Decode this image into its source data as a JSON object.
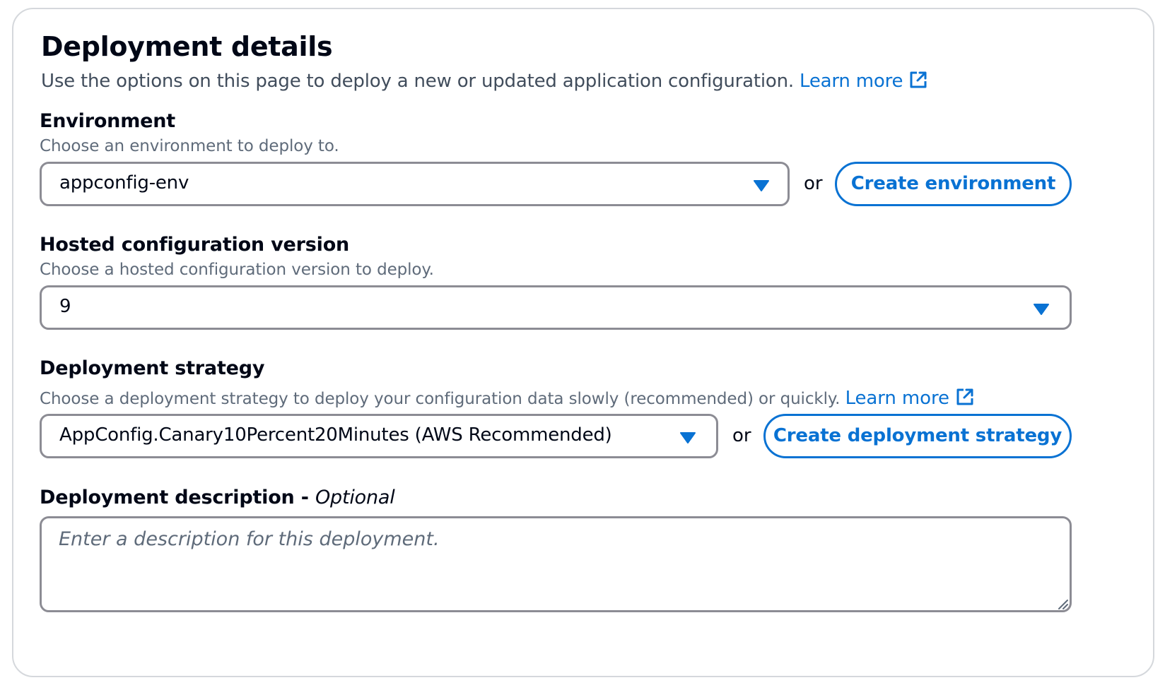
{
  "panel": {
    "title": "Deployment details",
    "description": "Use the options on this page to deploy a new or updated application configuration.",
    "learn_more": "Learn more"
  },
  "environment": {
    "label": "Environment",
    "hint": "Choose an environment to deploy to.",
    "selected": "appconfig-env",
    "or": "or",
    "create_button": "Create environment"
  },
  "hosted_version": {
    "label": "Hosted configuration version",
    "hint": "Choose a hosted configuration version to deploy.",
    "selected": "9"
  },
  "strategy": {
    "label": "Deployment strategy",
    "hint": "Choose a deployment strategy to deploy your configuration data slowly (recommended) or quickly.",
    "learn_more": "Learn more",
    "selected": "AppConfig.Canary10Percent20Minutes (AWS Recommended)",
    "or": "or",
    "create_button": "Create deployment strategy"
  },
  "deployment_description": {
    "label": "Deployment description",
    "separator": " - ",
    "optional": "Optional",
    "placeholder": "Enter a description for this deployment.",
    "value": ""
  },
  "colors": {
    "link": "#0972d3",
    "border": "#8c8c94",
    "text": "#000716",
    "secondary_text": "#5f6b7a"
  },
  "icons": {
    "external_link": "external-link-icon",
    "caret": "caret-down-icon",
    "resize": "resize-handle-icon"
  }
}
